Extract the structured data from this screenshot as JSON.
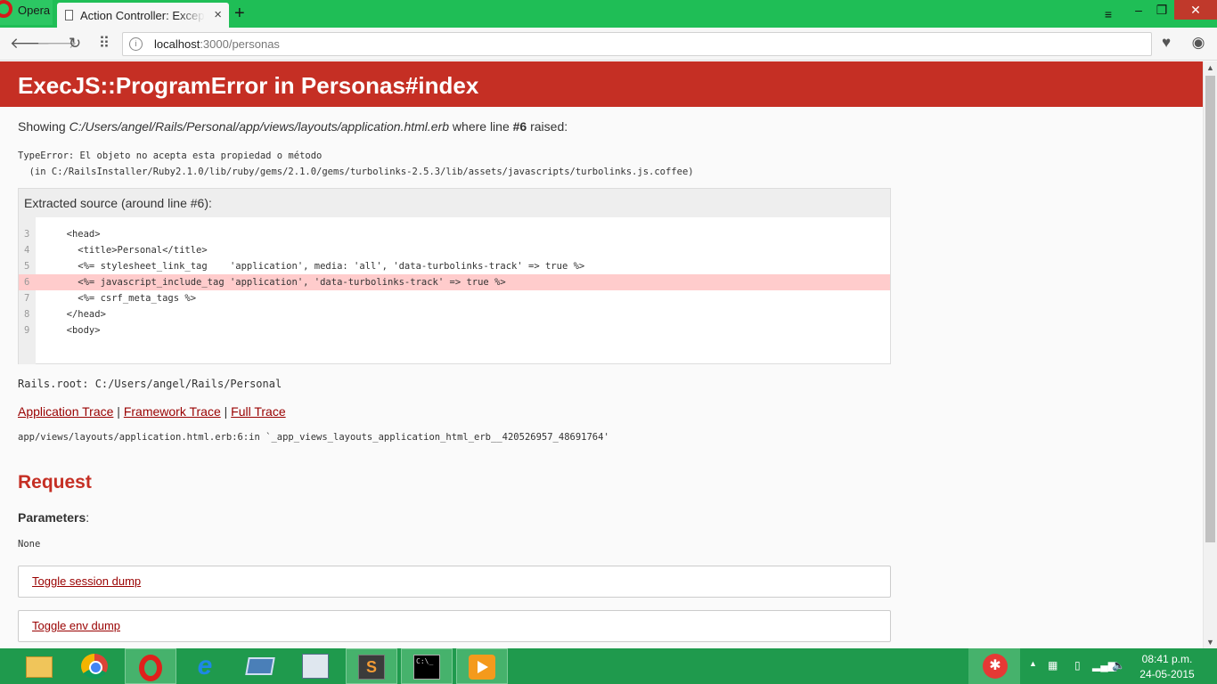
{
  "browser": {
    "menu_label": "Opera",
    "tab_title": "Action Controller: Exception caught",
    "tab_close": "×",
    "new_tab": "+",
    "url_host": "localhost",
    "url_path": ":3000/personas"
  },
  "page": {
    "error_title": "ExecJS::ProgramError in Personas#index",
    "showing_prefix": "Showing ",
    "showing_path": "C:/Users/angel/Rails/Personal/app/views/layouts/application.html.erb",
    "showing_mid": " where line ",
    "showing_line": "#6",
    "showing_suffix": " raised:",
    "type_error": "TypeError: El objeto no acepta esta propiedad o método\n  (in C:/RailsInstaller/Ruby2.1.0/lib/ruby/gems/2.1.0/gems/turbolinks-2.5.3/lib/assets/javascripts/turbolinks.js.coffee)",
    "extracted_header": "Extracted source (around line #6):",
    "source_lines": [
      {
        "n": "3",
        "code": "  <head>"
      },
      {
        "n": "4",
        "code": "    <title>Personal</title>"
      },
      {
        "n": "5",
        "code": "    <%= stylesheet_link_tag    'application', media: 'all', 'data-turbolinks-track' => true %>"
      },
      {
        "n": "6",
        "code": "    <%= javascript_include_tag 'application', 'data-turbolinks-track' => true %>"
      },
      {
        "n": "7",
        "code": "    <%= csrf_meta_tags %>"
      },
      {
        "n": "8",
        "code": "  </head>"
      },
      {
        "n": "9",
        "code": "  <body>"
      }
    ],
    "rails_root": "Rails.root: C:/Users/angel/Rails/Personal",
    "trace_links": [
      "Application Trace",
      "Framework Trace",
      "Full Trace"
    ],
    "trace_sep": " | ",
    "trace_line": "app/views/layouts/application.html.erb:6:in `_app_views_layouts_application_html_erb__420526957_48691764'",
    "request_heading": "Request",
    "parameters_label": "Parameters",
    "parameters_colon": ":",
    "parameters_value": "None",
    "toggle_session": "Toggle session dump",
    "toggle_env": "Toggle env dump"
  },
  "taskbar": {
    "apps": [
      "file-explorer",
      "chrome",
      "opera",
      "internet-explorer",
      "remote-desktop",
      "on-screen-keyboard",
      "sublime-text",
      "command-prompt",
      "media-player"
    ],
    "sublime_glyph": "S",
    "cmd_glyph": "C:\\_",
    "ie_glyph": "e",
    "clock_time": "08:41 p.m.",
    "clock_date": "24-05-2015"
  },
  "colors": {
    "error_red": "#c52f24",
    "highlight_row": "#ffcccc",
    "link": "#990000",
    "chrome_green": "#1fbe56"
  }
}
